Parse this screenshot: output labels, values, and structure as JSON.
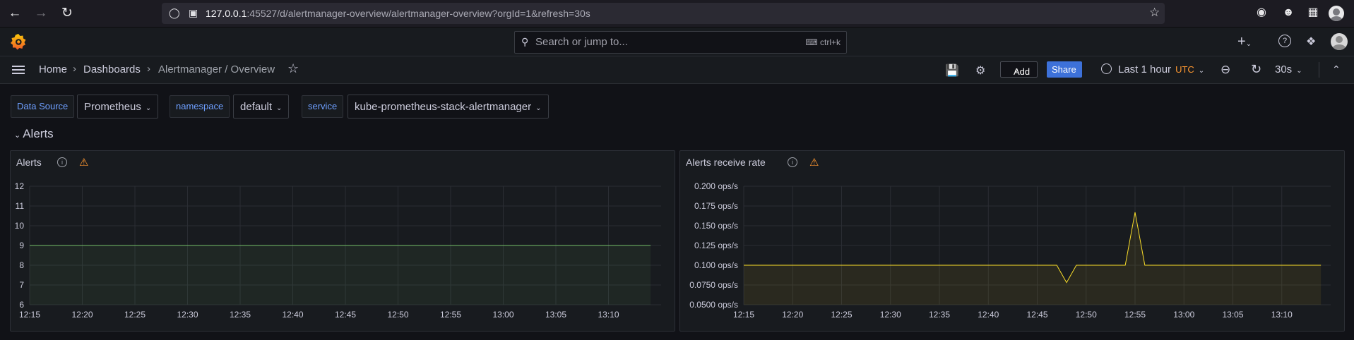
{
  "browser": {
    "url_host": "127.0.0.1",
    "url_path": ":45527/d/alertmanager-overview/alertmanager-overview?orgId=1&refresh=30s"
  },
  "topbar": {
    "search_placeholder": "Search or jump to...",
    "search_shortcut": "ctrl+k"
  },
  "breadcrumb": {
    "items": [
      "Home",
      "Dashboards",
      "Alertmanager / Overview"
    ]
  },
  "toolbar": {
    "add_label": "Add",
    "share_label": "Share",
    "time_range": "Last 1 hour",
    "timezone": "UTC",
    "refresh_interval": "30s"
  },
  "variables": [
    {
      "label": "Data Source",
      "value": "Prometheus"
    },
    {
      "label": "namespace",
      "value": "default"
    },
    {
      "label": "service",
      "value": "kube-prometheus-stack-alertmanager"
    }
  ],
  "row": {
    "title": "Alerts"
  },
  "colors": {
    "accent": "#3d71d9",
    "warning": "#ff9830",
    "series_green": "#73bf69",
    "series_yellow": "#fade2a"
  },
  "chart_data": [
    {
      "type": "area",
      "title": "Alerts",
      "x": [
        "12:15",
        "12:20",
        "12:25",
        "12:30",
        "12:35",
        "12:40",
        "12:45",
        "12:50",
        "12:55",
        "13:00",
        "13:05",
        "13:10"
      ],
      "yticks": [
        "12",
        "11",
        "10",
        "9",
        "8",
        "7",
        "6"
      ],
      "ylim": [
        6,
        12
      ],
      "series": [
        {
          "x": [
            "12:15",
            "13:14"
          ],
          "values": [
            9,
            9
          ],
          "color": "#73bf69"
        }
      ]
    },
    {
      "type": "area",
      "title": "Alerts receive rate",
      "x": [
        "12:15",
        "12:20",
        "12:25",
        "12:30",
        "12:35",
        "12:40",
        "12:45",
        "12:50",
        "12:55",
        "13:00",
        "13:05",
        "13:10"
      ],
      "yticks": [
        "0.200 ops/s",
        "0.175 ops/s",
        "0.150 ops/s",
        "0.125 ops/s",
        "0.100 ops/s",
        "0.0750 ops/s",
        "0.0500 ops/s"
      ],
      "ylim": [
        0.05,
        0.2
      ],
      "series": [
        {
          "x": [
            "12:15",
            "12:47",
            "12:48",
            "12:49",
            "12:54",
            "12:55",
            "12:56",
            "13:14"
          ],
          "values": [
            0.1,
            0.1,
            0.078,
            0.1,
            0.1,
            0.167,
            0.1,
            0.1
          ],
          "color": "#fade2a"
        }
      ]
    }
  ]
}
